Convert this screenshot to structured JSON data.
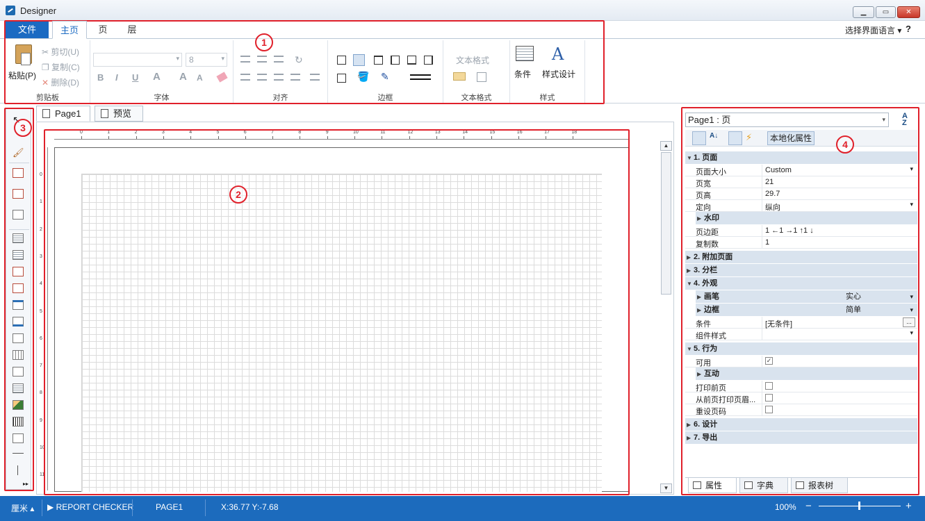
{
  "window": {
    "title": "Designer",
    "min": "▁",
    "max": "▭",
    "close": "✕"
  },
  "ribbon": {
    "tabs": {
      "file": "文件",
      "home": "主页",
      "page": "页",
      "layer": "层"
    },
    "ui_language": "选择界面语言 ▾",
    "help": "?",
    "clipboard": {
      "label": "剪贴板",
      "paste": "粘贴(P)",
      "cut": "剪切(U)",
      "copy": "复制(C)",
      "delete": "删除(D)"
    },
    "font": {
      "label": "字体",
      "size": "8",
      "bold": "B",
      "italic": "I",
      "underline": "U",
      "color": "A",
      "grow": "A",
      "shrink": "A"
    },
    "align": {
      "label": "对齐"
    },
    "border": {
      "label": "边框"
    },
    "textformat": {
      "label": "文本格式",
      "format": "文本格式"
    },
    "style": {
      "label": "样式",
      "conditions": "条件",
      "style_design": "样式设计"
    }
  },
  "callouts": {
    "one": "1",
    "two": "2",
    "three": "3",
    "four": "4"
  },
  "doc_tabs": {
    "page": "Page1",
    "preview": "预览"
  },
  "ruler": {
    "h": [
      "0",
      "1",
      "2",
      "3",
      "4",
      "5",
      "6",
      "7",
      "8",
      "9",
      "10",
      "11",
      "12",
      "13",
      "14",
      "15",
      "16",
      "17",
      "18"
    ],
    "v": [
      "0",
      "1",
      "2",
      "3",
      "4",
      "5",
      "6",
      "7",
      "8",
      "9",
      "10",
      "11"
    ]
  },
  "properties": {
    "object": "Page1 : 页",
    "localize": "本地化属性",
    "page_section": "1. 页面",
    "page_size": {
      "k": "页面大小",
      "v": "Custom"
    },
    "page_width": {
      "k": "页宽",
      "v": "21"
    },
    "page_height": {
      "k": "页高",
      "v": "29.7"
    },
    "orientation": {
      "k": "定向",
      "v": "纵向"
    },
    "watermark": "水印",
    "margins": {
      "k": "页边距",
      "v": "1   ←1     →1     ↑1     ↓"
    },
    "copies": {
      "k": "复制数",
      "v": "1"
    },
    "extra_pages": "2. 附加页面",
    "columns": "3. 分栏",
    "appearance": "4. 外观",
    "brush": {
      "k": "画笔",
      "v": "实心"
    },
    "border": {
      "k": "边框",
      "v": "简单"
    },
    "conditions": {
      "k": "条件",
      "v": "[无条件]"
    },
    "component_style": {
      "k": "组件样式",
      "v": ""
    },
    "behavior": "5. 行为",
    "enabled": {
      "k": "可用",
      "v": "✓"
    },
    "interaction": "互动",
    "print_on_previous": {
      "k": "打印前页"
    },
    "print_headers": {
      "k": "从前页打印页眉..."
    },
    "reset_page_number": {
      "k": "重设页码"
    },
    "design": "6. 设计",
    "export": "7. 导出",
    "tab_props": "属性",
    "tab_dictionary": "字典",
    "tab_report_tree": "报表树"
  },
  "status": {
    "unit": "厘米 ▴",
    "checker": "REPORT CHECKER",
    "page": "PAGE1",
    "coords": "X:36.77  Y:-7.68",
    "zoom": "100%",
    "zoom_minus": "−",
    "zoom_plus": "+"
  },
  "colors": {
    "accent": "#1c6bbd",
    "callout": "#e0202a"
  }
}
